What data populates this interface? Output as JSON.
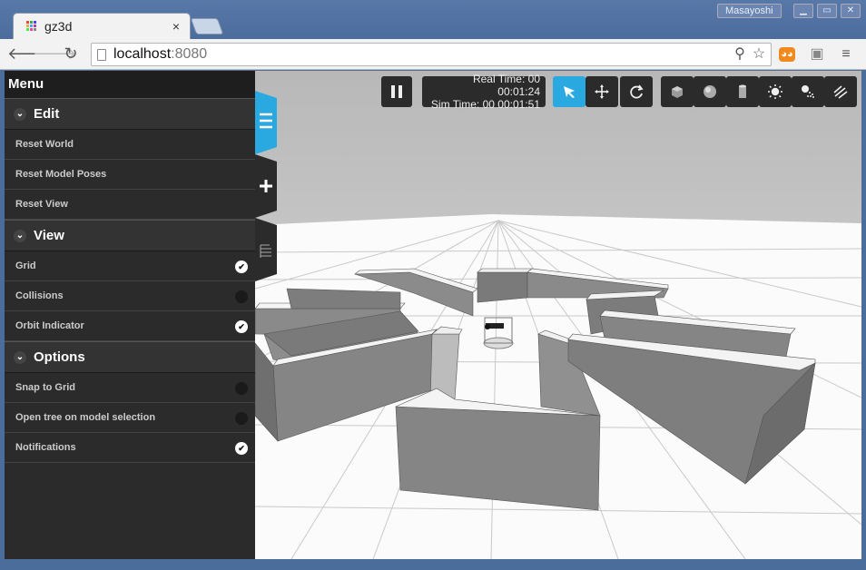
{
  "browser": {
    "tab_title": "gz3d",
    "tab_close": "×",
    "user_name": "Masayoshi",
    "url_host": "localhost",
    "url_port": ":8080"
  },
  "menu": {
    "title": "Menu",
    "sections": [
      {
        "label": "Edit",
        "items": [
          {
            "label": "Reset World"
          },
          {
            "label": "Reset Model Poses"
          },
          {
            "label": "Reset View"
          }
        ]
      },
      {
        "label": "View",
        "items": [
          {
            "label": "Grid",
            "checked": true
          },
          {
            "label": "Collisions",
            "checked": false
          },
          {
            "label": "Orbit Indicator",
            "checked": true
          }
        ]
      },
      {
        "label": "Options",
        "items": [
          {
            "label": "Snap to Grid",
            "checked": false
          },
          {
            "label": "Open tree on model selection",
            "checked": false
          },
          {
            "label": "Notifications",
            "checked": true
          }
        ]
      }
    ]
  },
  "time": {
    "real": "Real Time: 00 00:01:24",
    "sim": "Sim Time: 00 00:01:51"
  },
  "colors": {
    "accent": "#29a9e0",
    "panel": "#2b2b2b"
  },
  "icons": [
    "pause-icon",
    "select-icon",
    "translate-icon",
    "rotate-icon",
    "box-icon",
    "sphere-icon",
    "cylinder-icon",
    "pointlight-icon",
    "spotlight-icon",
    "directionallight-icon"
  ]
}
